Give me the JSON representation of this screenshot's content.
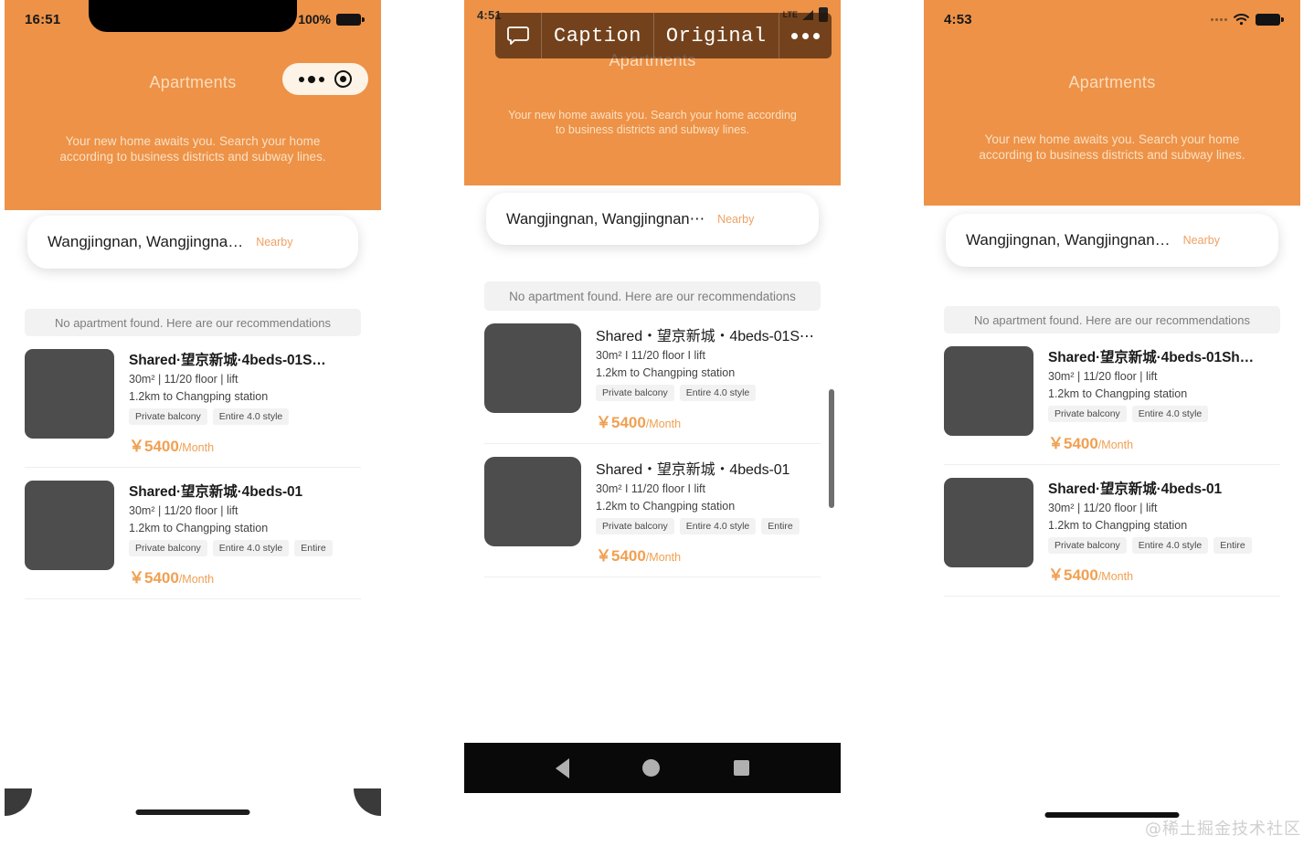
{
  "app": {
    "title": "Apartments",
    "subtitle": "Your new home awaits you. Search your home according to business districts and subway lines.",
    "accent_orange": "#ED9247",
    "price_orange": "#F0A052",
    "thumb_gray": "#4D4D4D"
  },
  "search": {
    "value": "Wangjingnan, Wangjingna…",
    "value_android": "Wangjingnan, Wangjingnan⋯",
    "value_ios2": "Wangjingnan, Wangjingnan…",
    "nearby_label": "Nearby"
  },
  "notice": {
    "text": "No apartment found. Here are our recommendations"
  },
  "panel_ios_1": {
    "status": {
      "time": "16:51",
      "battery_percent": "100%",
      "battery_icon": "battery-full-icon"
    },
    "capsule": {
      "more_icon": "more-dots-icon",
      "target_icon": "target-circle-icon"
    },
    "listings": [
      {
        "title": "Shared·望京新城·4beds-01S…",
        "meta": "30m² | 11/20 floor | lift",
        "distance": "1.2km to Changping station",
        "tags": [
          "Private balcony",
          "Entire 4.0 style"
        ],
        "currency": "￥",
        "price": "5400",
        "period": "/Month"
      },
      {
        "title": "Shared·望京新城·4beds-01",
        "meta": "30m² | 11/20 floor | lift",
        "distance": "1.2km to Changping station",
        "tags": [
          "Private balcony",
          "Entire 4.0 style",
          "Entire"
        ],
        "currency": "￥",
        "price": "5400",
        "period": "/Month"
      }
    ]
  },
  "panel_android": {
    "status": {
      "time": "4:51",
      "network": "LTE",
      "signal_icon": "signal-bars-icon",
      "battery_icon": "battery-icon"
    },
    "toolbar": {
      "bubble_icon": "speech-bubble-icon",
      "caption_label": "Caption",
      "original_label": "Original",
      "more_icon": "more-dots-icon"
    },
    "listings": [
      {
        "title": "Shared・望京新城・4beds-01S⋯",
        "meta": "30m² I 11/20 floor I lift",
        "distance": "1.2km to Changping station",
        "tags": [
          "Private balcony",
          "Entire 4.0 style"
        ],
        "currency": "￥",
        "price": "5400",
        "period": "/Month"
      },
      {
        "title": "Shared・望京新城・4beds-01",
        "meta": "30m² I 11/20 floor I lift",
        "distance": "1.2km to Changping station",
        "tags": [
          "Private balcony",
          "Entire 4.0 style",
          "Entire"
        ],
        "currency": "￥",
        "price": "5400",
        "period": "/Month"
      }
    ],
    "navbar": {
      "back_icon": "nav-back-icon",
      "home_icon": "nav-home-icon",
      "recents_icon": "nav-recents-icon"
    }
  },
  "panel_ios_2": {
    "status": {
      "time": "4:53",
      "wifi_icon": "wifi-icon",
      "battery_icon": "battery-full-icon",
      "signal_icon": "signal-dots-icon"
    },
    "listings": [
      {
        "title": "Shared·望京新城·4beds-01Sh…",
        "meta": "30m² | 11/20 floor | lift",
        "distance": "1.2km to Changping station",
        "tags": [
          "Private balcony",
          "Entire 4.0 style"
        ],
        "currency": "￥",
        "price": "5400",
        "period": "/Month"
      },
      {
        "title": "Shared·望京新城·4beds-01",
        "meta": "30m² | 11/20 floor | lift",
        "distance": "1.2km to Changping station",
        "tags": [
          "Private balcony",
          "Entire 4.0 style",
          "Entire"
        ],
        "currency": "￥",
        "price": "5400",
        "period": "/Month"
      }
    ]
  },
  "watermark": {
    "text": "@稀土掘金技术社区"
  }
}
